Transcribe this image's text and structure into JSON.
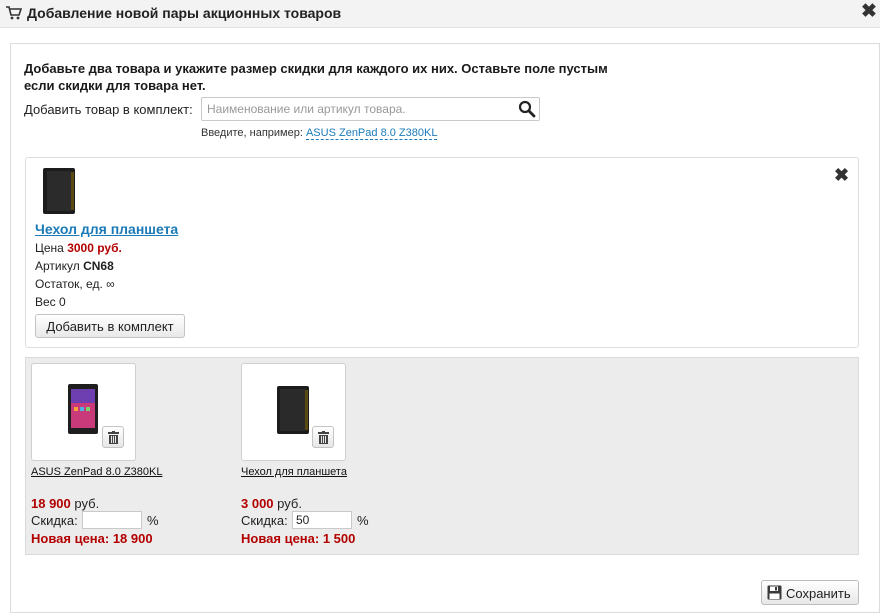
{
  "window": {
    "title": "Добавление новой пары акционных товаров",
    "title_icon": "cart-icon",
    "close_icon": "close-icon"
  },
  "intro": {
    "text": "Добавьте два товара и укажите размер скидки для каждого их них. Оставьте поле пустым если скидки для товара нет."
  },
  "search": {
    "label": "Добавить товар в комплект:",
    "placeholder": "Наименование или артикул товара.",
    "value": "",
    "hint_prefix": "Введите, например:",
    "hint_example": "ASUS ZenPad 8.0 Z380KL",
    "icon": "search-icon"
  },
  "product": {
    "name": "Чехол для планшета",
    "price_label": "Цена",
    "price_value": "3000 руб.",
    "sku_label": "Артикул",
    "sku_value": "CN68",
    "stock_label": "Остаток, ед.",
    "stock_value": "∞",
    "weight_label": "Вес",
    "weight_value": "0",
    "add_button": "Добавить в комплект"
  },
  "bundle": {
    "items": [
      {
        "name": "ASUS ZenPad 8.0 Z380KL",
        "price": "18 900",
        "currency": "руб.",
        "discount_label": "Скидка:",
        "discount_value": "",
        "percent": "%",
        "new_price": "Новая цена: 18 900"
      },
      {
        "name": "Чехол для планшета",
        "price": "3 000",
        "currency": "руб.",
        "discount_label": "Скидка:",
        "discount_value": "50",
        "percent": "%",
        "new_price": "Новая цена: 1 500"
      }
    ]
  },
  "footer": {
    "save_label": "Сохранить"
  },
  "colors": {
    "link": "#1a7ab8",
    "price": "#b30000",
    "panel": "#ececec"
  }
}
